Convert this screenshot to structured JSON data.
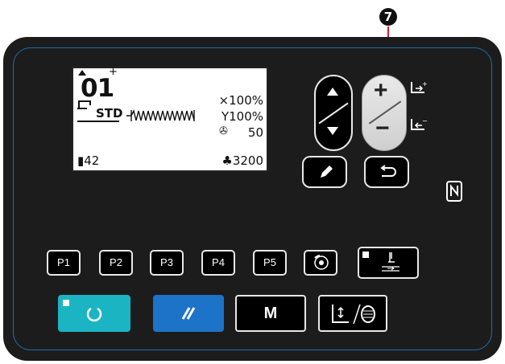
{
  "callout": {
    "number": "7"
  },
  "lcd": {
    "pattern_number": "01",
    "mode_label": "STD",
    "x_scale": "×100%",
    "y_scale": "Y100%",
    "speed": "50",
    "counter_left": "42",
    "counter_right": "3200"
  },
  "buttons": {
    "p1": "P1",
    "p2": "P2",
    "p3": "P3",
    "p4": "P4",
    "p5": "P5",
    "m": "M"
  },
  "icons": {
    "up": "triangle-up-icon",
    "down": "triangle-down-icon",
    "plus": "plus-icon",
    "minus": "minus-icon",
    "pencil": "pencil-icon",
    "return": "return-icon",
    "nfc": "nfc-icon",
    "thread_tension": "thread-tension-icon",
    "presser": "presser-foot-icon",
    "start": "ready-icon",
    "reset": "reset-icon",
    "winder": "bobbin-winder-icon"
  },
  "colors": {
    "panel": "#1c1c1c",
    "accent_blue": "#1e6fb3",
    "ready_button": "#1ab4c3",
    "reset_button": "#1d73c7",
    "callout_arrow": "#d11f2a"
  }
}
